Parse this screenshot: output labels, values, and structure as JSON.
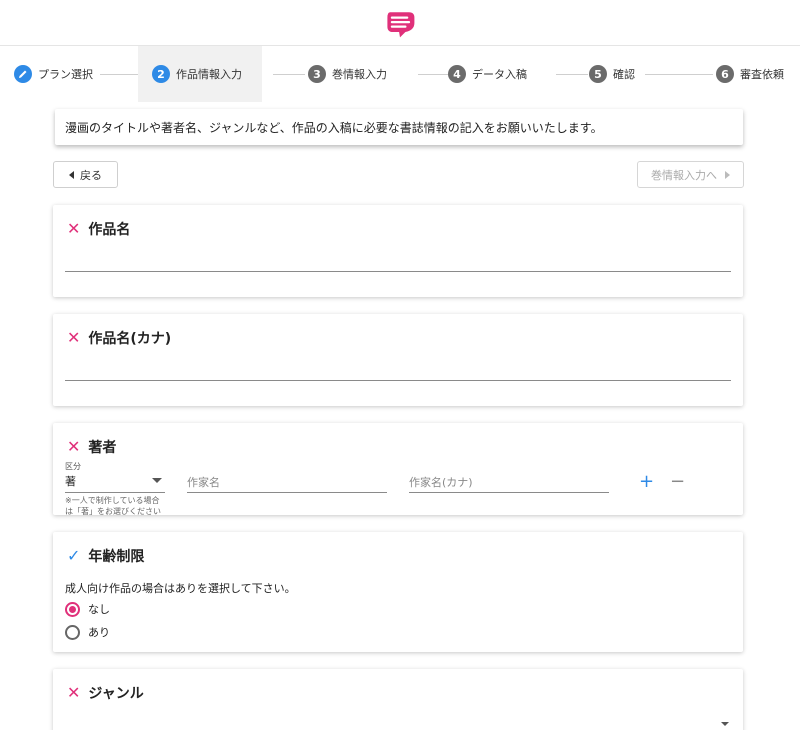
{
  "colors": {
    "accent": "#e0307a",
    "primary": "#2e8ae6",
    "step_inactive": "#6b6b6b"
  },
  "header": {
    "logo_icon": "logo-icon"
  },
  "steps": [
    {
      "number": "",
      "icon": "pencil-icon",
      "label": "プラン選択"
    },
    {
      "number": "2",
      "label": "作品情報入力"
    },
    {
      "number": "3",
      "label": "巻情報入力"
    },
    {
      "number": "4",
      "label": "データ入稿"
    },
    {
      "number": "5",
      "label": "確認"
    },
    {
      "number": "6",
      "label": "審査依頼"
    }
  ],
  "instruction": "漫画のタイトルや著者名、ジャンルなど、作品の入稿に必要な書誌情報の記入をお願いいたします。",
  "nav": {
    "back_label": "戻る",
    "next_label": "巻情報入力へ"
  },
  "sections": {
    "title": {
      "label": "作品名",
      "value": ""
    },
    "title_kana": {
      "label": "作品名(カナ)",
      "value": ""
    },
    "author": {
      "label": "著者",
      "category_label": "区分",
      "category_value": "著",
      "hint": "※一人で制作している場合は「著」をお選びください",
      "name_placeholder": "作家名",
      "name_kana_placeholder": "作家名(カナ)",
      "add_label": "+",
      "remove_label": "−"
    },
    "age": {
      "label": "年齢制限",
      "note": "成人向け作品の場合はありを選択して下さい。",
      "options": [
        {
          "label": "なし",
          "selected": true
        },
        {
          "label": "あり",
          "selected": false
        }
      ]
    },
    "genre": {
      "label": "ジャンル",
      "value": ""
    }
  }
}
